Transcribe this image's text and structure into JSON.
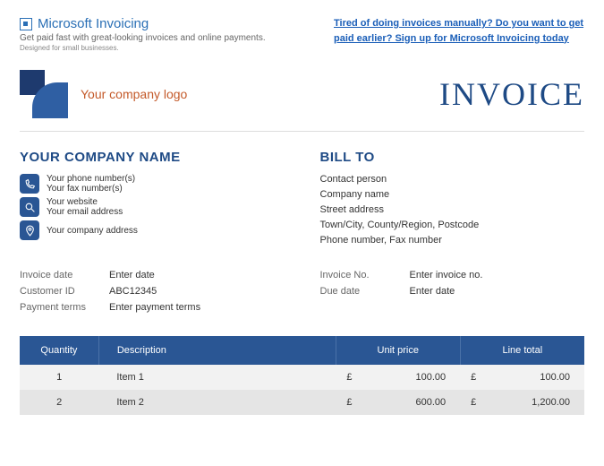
{
  "header": {
    "brand": "Microsoft Invoicing",
    "tagline": "Get paid fast with great-looking invoices and online payments.",
    "subtag": "Designed for small businesses.",
    "promo": "Tired of doing invoices manually? Do you want to get paid earlier? Sign up for Microsoft Invoicing today"
  },
  "logo": {
    "placeholder": "Your company logo",
    "title": "INVOICE"
  },
  "company": {
    "heading": "YOUR COMPANY NAME",
    "phone": "Your phone number(s)",
    "fax": "Your fax number(s)",
    "website": "Your website",
    "email": "Your email address",
    "address": "Your company address"
  },
  "billto": {
    "heading": "BILL TO",
    "contact": "Contact person",
    "company": "Company name",
    "street": "Street address",
    "city": "Town/City, County/Region, Postcode",
    "phone": "Phone number, Fax number"
  },
  "meta_left": {
    "invoice_date_label": "Invoice date",
    "invoice_date_value": "Enter date",
    "customer_id_label": "Customer ID",
    "customer_id_value": "ABC12345",
    "payment_terms_label": "Payment terms",
    "payment_terms_value": "Enter payment terms"
  },
  "meta_right": {
    "invoice_no_label": "Invoice No.",
    "invoice_no_value": "Enter invoice no.",
    "due_date_label": "Due date",
    "due_date_value": "Enter date"
  },
  "table": {
    "headers": {
      "qty": "Quantity",
      "desc": "Description",
      "unit": "Unit price",
      "total": "Line total"
    },
    "currency": "£",
    "rows": [
      {
        "qty": "1",
        "desc": "Item 1",
        "unit": "100.00",
        "total": "100.00"
      },
      {
        "qty": "2",
        "desc": "Item 2",
        "unit": "600.00",
        "total": "1,200.00"
      }
    ]
  }
}
